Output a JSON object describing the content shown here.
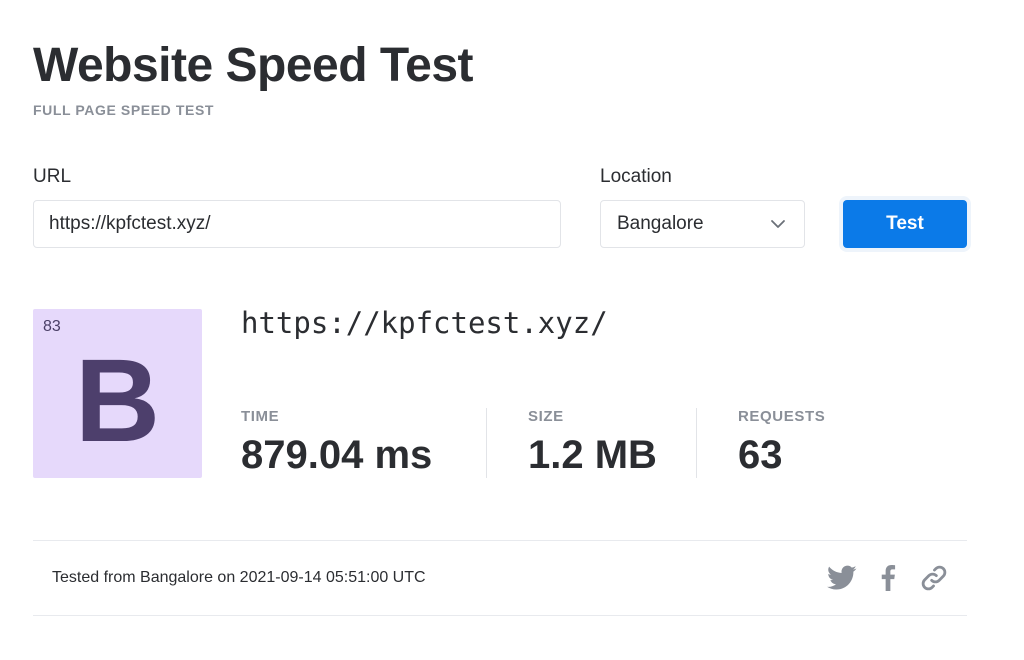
{
  "header": {
    "title": "Website Speed Test",
    "subtitle": "FULL PAGE SPEED TEST"
  },
  "form": {
    "url_label": "URL",
    "url_value": "https://kpfctest.xyz/",
    "location_label": "Location",
    "location_value": "Bangalore",
    "test_button_label": "Test"
  },
  "result": {
    "grade_score": "83",
    "grade_letter": "B",
    "url": "https://kpfctest.xyz/",
    "metrics": [
      {
        "label": "TIME",
        "value": "879.04 ms"
      },
      {
        "label": "SIZE",
        "value": "1.2 MB"
      },
      {
        "label": "REQUESTS",
        "value": "63"
      }
    ]
  },
  "footer": {
    "tested_text": "Tested from Bangalore on 2021-09-14 05:51:00 UTC",
    "share_icons": [
      "twitter-icon",
      "facebook-icon",
      "link-icon"
    ]
  },
  "colors": {
    "accent": "#0b7ae8",
    "grade_bg": "#e6d9fb",
    "grade_fg": "#4d3f6c",
    "muted": "#8a8f98",
    "icon": "#8a8f98"
  }
}
